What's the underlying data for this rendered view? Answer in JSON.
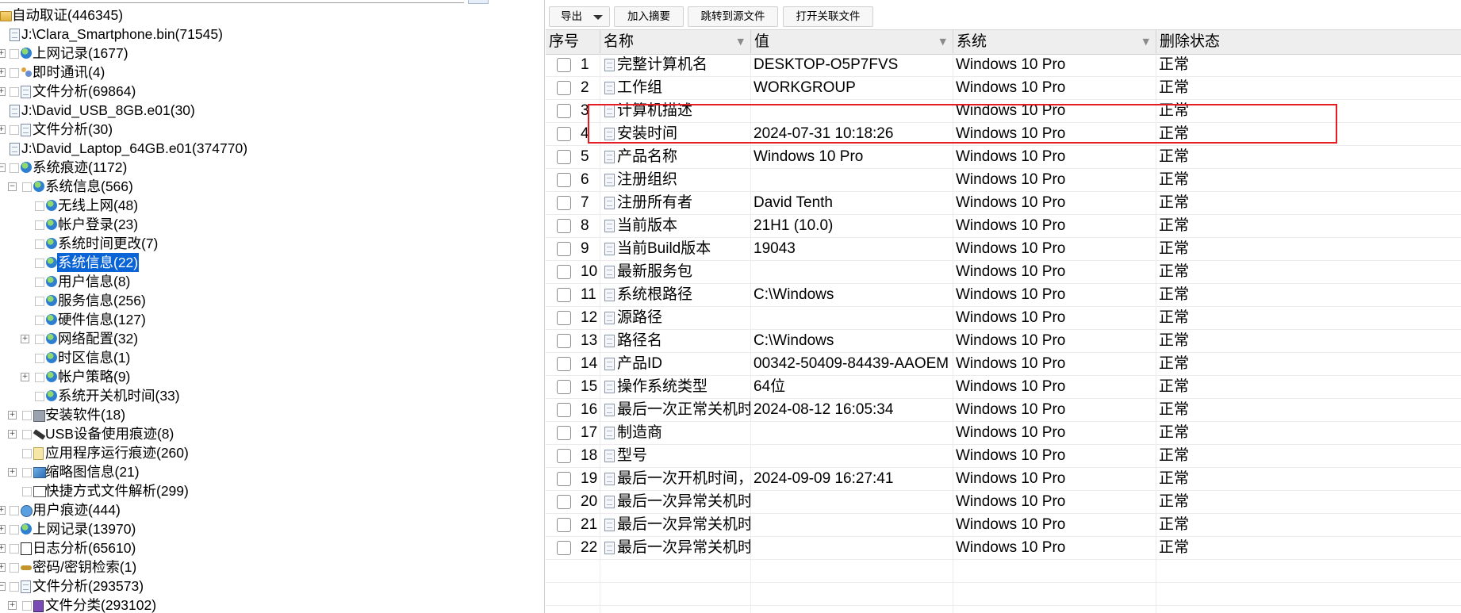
{
  "tree": {
    "items": [
      {
        "label": "自动取证(446345)",
        "level": 0,
        "icon": "folder-icon",
        "expander": "none",
        "checkbox": false
      },
      {
        "label": "J:\\Clara_Smartphone.bin(71545)",
        "level": 1,
        "icon": "document-icon",
        "expander": "none",
        "checkbox": false
      },
      {
        "label": "上网记录(1677)",
        "level": 2,
        "icon": "globe-icon",
        "expander": "collapsed",
        "checkbox": true
      },
      {
        "label": "即时通讯(4)",
        "level": 2,
        "icon": "contacts-icon",
        "expander": "collapsed",
        "checkbox": true
      },
      {
        "label": "文件分析(69864)",
        "level": 2,
        "icon": "document-icon",
        "expander": "collapsed",
        "checkbox": true
      },
      {
        "label": "J:\\David_USB_8GB.e01(30)",
        "level": 1,
        "icon": "document-icon",
        "expander": "none",
        "checkbox": false
      },
      {
        "label": "文件分析(30)",
        "level": 2,
        "icon": "document-icon",
        "expander": "collapsed",
        "checkbox": true
      },
      {
        "label": "J:\\David_Laptop_64GB.e01(374770)",
        "level": 1,
        "icon": "document-icon",
        "expander": "none",
        "checkbox": false
      },
      {
        "label": "系统痕迹(1172)",
        "level": 2,
        "icon": "globe-icon",
        "expander": "expanded",
        "checkbox": true
      },
      {
        "label": "系统信息(566)",
        "level": 3,
        "icon": "globe-icon",
        "expander": "expanded",
        "checkbox": true
      },
      {
        "label": "无线上网(48)",
        "level": 4,
        "icon": "globe-icon",
        "expander": "none",
        "checkbox": true
      },
      {
        "label": "帐户登录(23)",
        "level": 4,
        "icon": "globe-icon",
        "expander": "none",
        "checkbox": true
      },
      {
        "label": "系统时间更改(7)",
        "level": 4,
        "icon": "globe-icon",
        "expander": "none",
        "checkbox": true
      },
      {
        "label": "系统信息(22)",
        "level": 4,
        "icon": "globe-icon",
        "expander": "none",
        "checkbox": true,
        "selected": true
      },
      {
        "label": "用户信息(8)",
        "level": 4,
        "icon": "globe-icon",
        "expander": "none",
        "checkbox": true
      },
      {
        "label": "服务信息(256)",
        "level": 4,
        "icon": "globe-icon",
        "expander": "none",
        "checkbox": true
      },
      {
        "label": "硬件信息(127)",
        "level": 4,
        "icon": "globe-icon",
        "expander": "none",
        "checkbox": true
      },
      {
        "label": "网络配置(32)",
        "level": 4,
        "icon": "globe-icon",
        "expander": "collapsed",
        "checkbox": true
      },
      {
        "label": "时区信息(1)",
        "level": 4,
        "icon": "globe-icon",
        "expander": "none",
        "checkbox": true
      },
      {
        "label": "帐户策略(9)",
        "level": 4,
        "icon": "globe-icon",
        "expander": "collapsed",
        "checkbox": true
      },
      {
        "label": "系统开关机时间(33)",
        "level": 4,
        "icon": "globe-icon",
        "expander": "none",
        "checkbox": true
      },
      {
        "label": "安装软件(18)",
        "level": 3,
        "icon": "package-icon",
        "expander": "collapsed",
        "checkbox": true
      },
      {
        "label": "USB设备使用痕迹(8)",
        "level": 3,
        "icon": "usb-icon",
        "expander": "collapsed",
        "checkbox": true
      },
      {
        "label": "应用程序运行痕迹(260)",
        "level": 3,
        "icon": "app-icon",
        "expander": "none",
        "checkbox": true
      },
      {
        "label": "缩略图信息(21)",
        "level": 3,
        "icon": "thumbnail-icon",
        "expander": "collapsed",
        "checkbox": true
      },
      {
        "label": "快捷方式文件解析(299)",
        "level": 3,
        "icon": "shortcut-icon",
        "expander": "none",
        "checkbox": true
      },
      {
        "label": "用户痕迹(444)",
        "level": 2,
        "icon": "user-icon",
        "expander": "collapsed",
        "checkbox": true
      },
      {
        "label": "上网记录(13970)",
        "level": 2,
        "icon": "globe-icon",
        "expander": "collapsed",
        "checkbox": true
      },
      {
        "label": "日志分析(65610)",
        "level": 2,
        "icon": "log-icon",
        "expander": "collapsed",
        "checkbox": true
      },
      {
        "label": "密码/密钥检索(1)",
        "level": 2,
        "icon": "key-icon",
        "expander": "collapsed",
        "checkbox": true
      },
      {
        "label": "文件分析(293573)",
        "level": 2,
        "icon": "document-icon",
        "expander": "expanded",
        "checkbox": true
      },
      {
        "label": "文件分类(293102)",
        "level": 3,
        "icon": "file-category-icon",
        "expander": "collapsed",
        "checkbox": true
      }
    ]
  },
  "toolbar": {
    "export_label": "导出",
    "add_summary_label": "加入摘要",
    "jump_source_label": "跳转到源文件",
    "open_related_label": "打开关联文件"
  },
  "grid": {
    "headers": {
      "index": "序号",
      "name": "名称",
      "value": "值",
      "system": "系统",
      "delete_status": "删除状态"
    },
    "rows": [
      {
        "index": "1",
        "name": "完整计算机名",
        "value": "DESKTOP-O5P7FVS",
        "system": "Windows 10 Pro",
        "status": "正常"
      },
      {
        "index": "2",
        "name": "工作组",
        "value": "WORKGROUP",
        "system": "Windows 10 Pro",
        "status": "正常"
      },
      {
        "index": "3",
        "name": "计算机描述",
        "value": "",
        "system": "Windows 10 Pro",
        "status": "正常"
      },
      {
        "index": "4",
        "name": "安装时间",
        "value": "2024-07-31 10:18:26",
        "system": "Windows 10 Pro",
        "status": "正常"
      },
      {
        "index": "5",
        "name": "产品名称",
        "value": "Windows 10 Pro",
        "system": "Windows 10 Pro",
        "status": "正常"
      },
      {
        "index": "6",
        "name": "注册组织",
        "value": "",
        "system": "Windows 10 Pro",
        "status": "正常"
      },
      {
        "index": "7",
        "name": "注册所有者",
        "value": "David Tenth",
        "system": "Windows 10 Pro",
        "status": "正常"
      },
      {
        "index": "8",
        "name": "当前版本",
        "value": "21H1 (10.0)",
        "system": "Windows 10 Pro",
        "status": "正常"
      },
      {
        "index": "9",
        "name": "当前Build版本",
        "value": "19043",
        "system": "Windows 10 Pro",
        "status": "正常"
      },
      {
        "index": "10",
        "name": "最新服务包",
        "value": "",
        "system": "Windows 10 Pro",
        "status": "正常"
      },
      {
        "index": "11",
        "name": "系统根路径",
        "value": "C:\\Windows",
        "system": "Windows 10 Pro",
        "status": "正常"
      },
      {
        "index": "12",
        "name": "源路径",
        "value": "",
        "system": "Windows 10 Pro",
        "status": "正常"
      },
      {
        "index": "13",
        "name": "路径名",
        "value": "C:\\Windows",
        "system": "Windows 10 Pro",
        "status": "正常"
      },
      {
        "index": "14",
        "name": "产品ID",
        "value": "00342-50409-84439-AAOEM",
        "system": "Windows 10 Pro",
        "status": "正常"
      },
      {
        "index": "15",
        "name": "操作系统类型",
        "value": "64位",
        "system": "Windows 10 Pro",
        "status": "正常"
      },
      {
        "index": "16",
        "name": "最后一次正常关机时间",
        "value": "2024-08-12 16:05:34",
        "system": "Windows 10 Pro",
        "status": "正常"
      },
      {
        "index": "17",
        "name": "制造商",
        "value": "",
        "system": "Windows 10 Pro",
        "status": "正常"
      },
      {
        "index": "18",
        "name": "型号",
        "value": "",
        "system": "Windows 10 Pro",
        "status": "正常"
      },
      {
        "index": "19",
        "name": "最后一次开机时间，未...",
        "value": "2024-09-09 16:27:41",
        "system": "Windows 10 Pro",
        "status": "正常"
      },
      {
        "index": "20",
        "name": "最后一次异常关机时间",
        "value": "",
        "system": "Windows 10 Pro",
        "status": "正常"
      },
      {
        "index": "21",
        "name": "最后一次异常关机时间",
        "value": "",
        "system": "Windows 10 Pro",
        "status": "正常"
      },
      {
        "index": "22",
        "name": "最后一次异常关机时间",
        "value": "",
        "system": "Windows 10 Pro",
        "status": "正常"
      }
    ]
  },
  "colors": {
    "selection": "#0a64d6",
    "highlight_box": "#e51c24",
    "header_bg": "#eeeeee"
  }
}
